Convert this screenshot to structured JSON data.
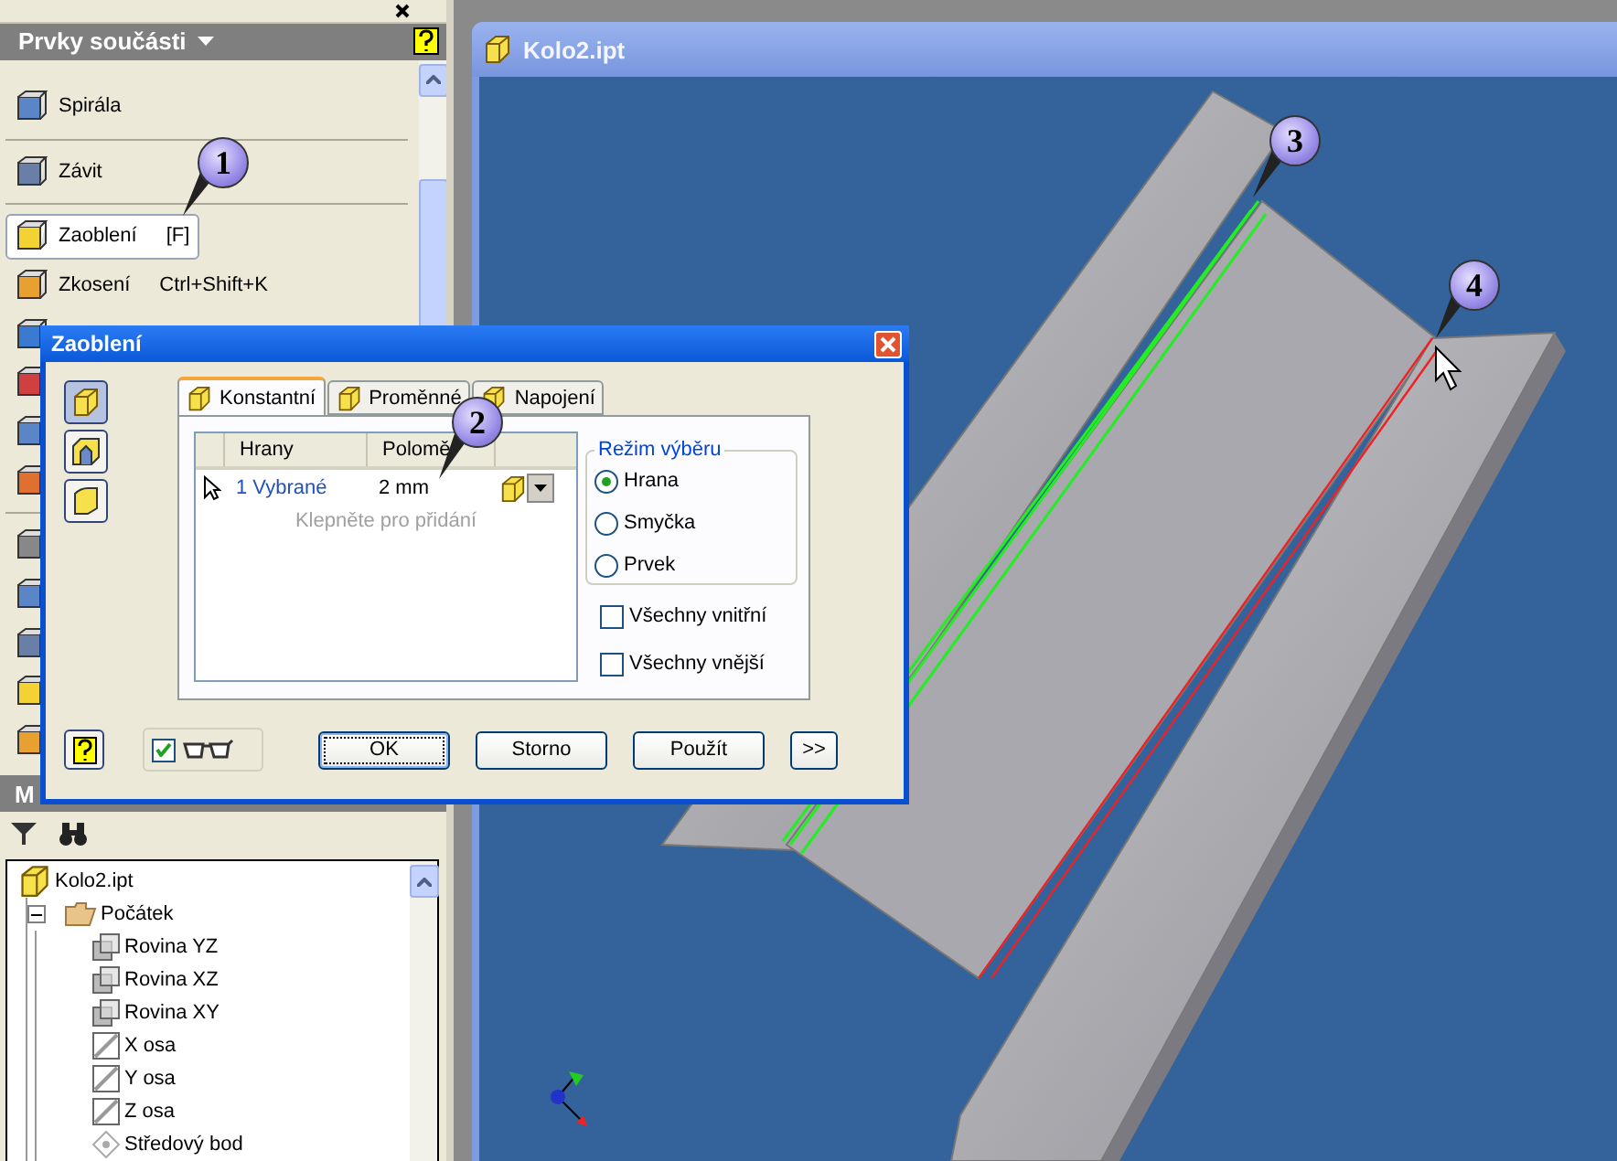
{
  "panel": {
    "title": "Prvky součásti",
    "items": [
      {
        "label": "Spirála",
        "selected": false,
        "separator_after": true
      },
      {
        "label": "Závit",
        "selected": false,
        "separator_after": true
      },
      {
        "label": "Zaoblení",
        "shortcut": "[F]",
        "selected": true,
        "separator_after": false
      },
      {
        "label": "Zkosení",
        "shortcut": "Ctrl+Shift+K",
        "selected": false,
        "separator_after": false
      }
    ]
  },
  "browser": {
    "title": "M",
    "tree": [
      {
        "label": "Kolo2.ipt",
        "kind": "part",
        "children": [
          {
            "label": "Počátek",
            "kind": "folder",
            "expanded": true,
            "children": [
              {
                "label": "Rovina YZ",
                "kind": "plane"
              },
              {
                "label": "Rovina XZ",
                "kind": "plane"
              },
              {
                "label": "Rovina XY",
                "kind": "plane"
              },
              {
                "label": "X osa",
                "kind": "axis"
              },
              {
                "label": "Y osa",
                "kind": "axis"
              },
              {
                "label": "Z osa",
                "kind": "axis"
              },
              {
                "label": "Středový bod",
                "kind": "point"
              }
            ]
          }
        ]
      }
    ]
  },
  "viewport": {
    "title": "Kolo2.ipt"
  },
  "callouts": [
    "1",
    "2",
    "3",
    "4"
  ],
  "dialog": {
    "title": "Zaoblení",
    "modes": [
      {
        "kind": "edge",
        "selected": true
      },
      {
        "kind": "face",
        "selected": false
      },
      {
        "kind": "full",
        "selected": false
      }
    ],
    "tabs": [
      {
        "label": "Konstantní",
        "selected": true
      },
      {
        "label": "Proměnné",
        "selected": false
      },
      {
        "label": "Napojení",
        "selected": false
      }
    ],
    "table": {
      "columns": [
        "Hrany",
        "Polomě"
      ],
      "rows": [
        {
          "edges": "1 Vybrané",
          "radius": "2 mm"
        }
      ],
      "add_hint": "Klepněte pro přidání"
    },
    "selection_mode": {
      "title": "Režim výběru",
      "options": [
        {
          "label": "Hrana",
          "selected": true
        },
        {
          "label": "Smyčka",
          "selected": false
        },
        {
          "label": "Prvek",
          "selected": false
        }
      ]
    },
    "checkboxes": [
      {
        "label": "Všechny vnitřní",
        "checked": false
      },
      {
        "label": "Všechny vnější",
        "checked": false
      }
    ],
    "preview": {
      "checked": true
    },
    "buttons": [
      {
        "label": "OK",
        "default": true
      },
      {
        "label": "Storno",
        "default": false
      },
      {
        "label": "Použít",
        "default": false
      },
      {
        "label": ">>",
        "default": false
      }
    ]
  }
}
